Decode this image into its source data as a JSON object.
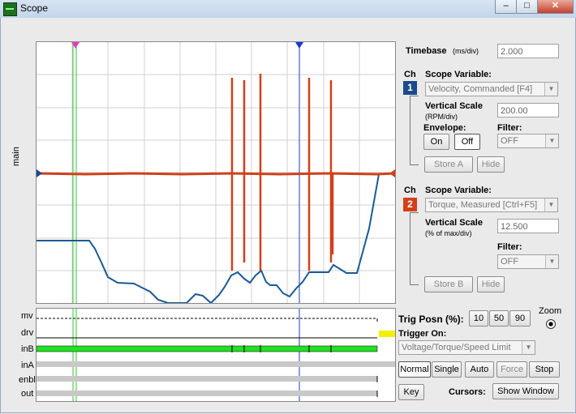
{
  "window": {
    "title": "Scope",
    "min_label": "–",
    "max_label": "□",
    "close_label": "✕"
  },
  "plot": {
    "ylabel": "main"
  },
  "digital": {
    "channels": [
      "mv",
      "drv",
      "inB",
      "inA",
      "enbl",
      "out"
    ]
  },
  "timebase": {
    "label": "Timebase",
    "unit": "(ms/div)",
    "value": "2.000"
  },
  "ch_label": "Ch",
  "ch1": {
    "number": "1",
    "color": "#1a4a8a",
    "scope_variable_label": "Scope Variable:",
    "scope_variable": "Velocity, Commanded [F4]",
    "vertical_scale_label": "Vertical Scale",
    "vertical_scale_unit": "(RPM/div)",
    "vertical_scale": "200.00",
    "envelope_label": "Envelope:",
    "envelope_on": "On",
    "envelope_off": "Off",
    "filter_label": "Filter:",
    "filter": "OFF",
    "store_label": "Store A",
    "hide_label": "Hide"
  },
  "ch2": {
    "number": "2",
    "color": "#d2401a",
    "scope_variable_label": "Scope Variable:",
    "scope_variable": "Torque, Measured [Ctrl+F5]",
    "vertical_scale_label": "Vertical Scale",
    "vertical_scale_unit": "(% of max/div)",
    "vertical_scale": "12.500",
    "filter_label": "Filter:",
    "filter": "OFF",
    "store_label": "Store B",
    "hide_label": "Hide"
  },
  "trigger": {
    "posn_label": "Trig Posn (%):",
    "posn_options": [
      "10",
      "50",
      "90"
    ],
    "zoom_label": "Zoom",
    "on_label": "Trigger On:",
    "on_value": "Voltage/Torque/Speed Limit",
    "modes": [
      "Normal",
      "Single",
      "Auto",
      "Force",
      "Stop"
    ]
  },
  "bottom": {
    "key_label": "Key",
    "cursors_label": "Cursors:",
    "show_window_label": "Show Window"
  },
  "colors": {
    "velocity_trace": "#1a5a96",
    "torque_trace": "#d2401a",
    "cursor_green": "#34c834",
    "cursor_blue": "#1a3ad2",
    "cursor_magenta": "#e040c0",
    "inB_fill": "#22e022"
  }
}
